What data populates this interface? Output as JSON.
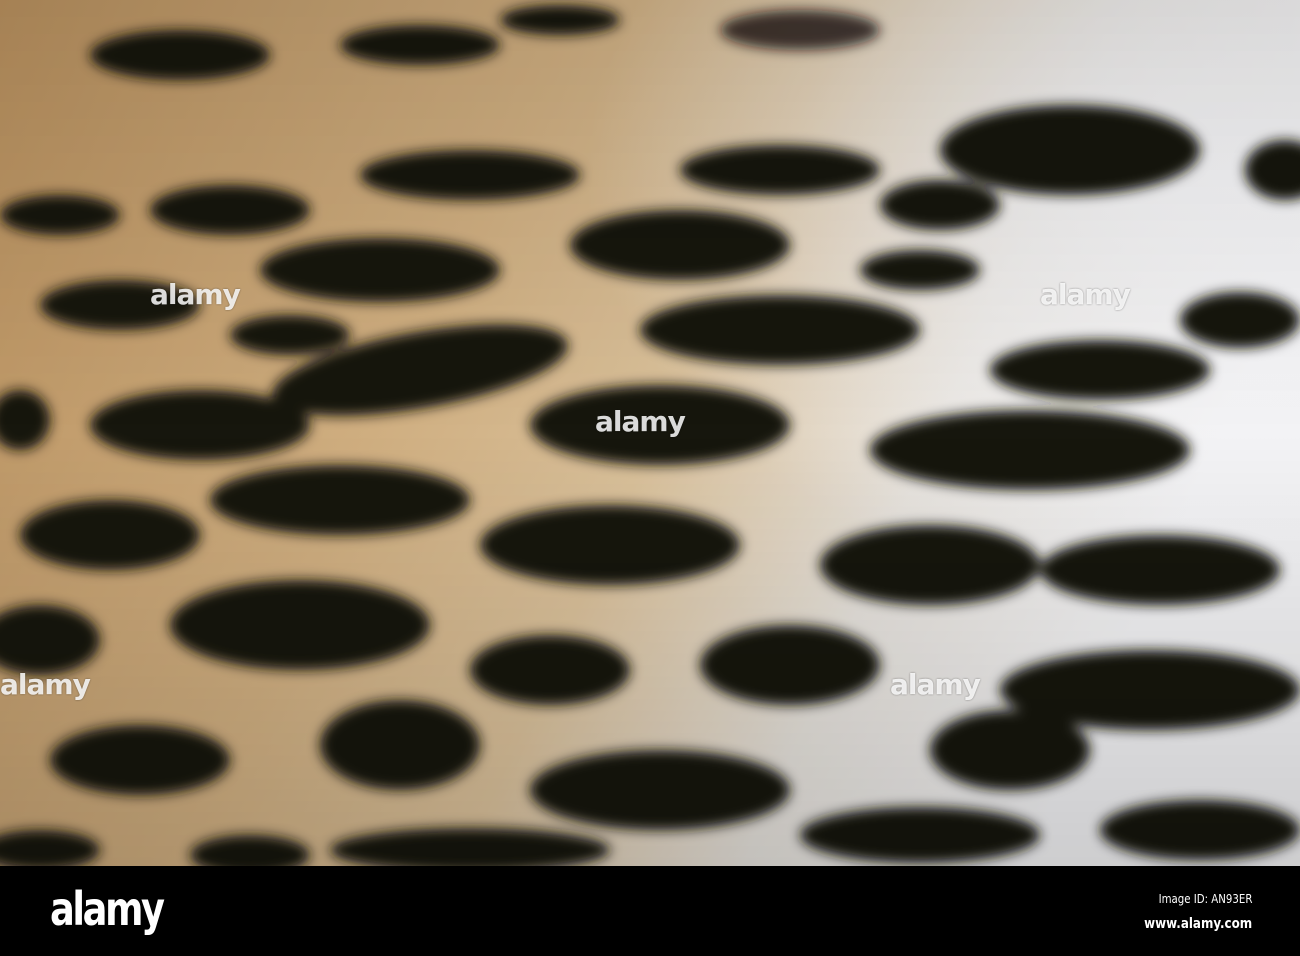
{
  "photo": {
    "subject": "leopard fur",
    "watermark": "alamy"
  },
  "footer": {
    "logo": "alamy",
    "image_id": "Image ID: AN93ER",
    "url": "www.alamy.com"
  },
  "colors": {
    "fur": "#c9a77a",
    "spot": "#141210",
    "white_fur": "#e8e8ea",
    "footer_bg": "#000000"
  }
}
